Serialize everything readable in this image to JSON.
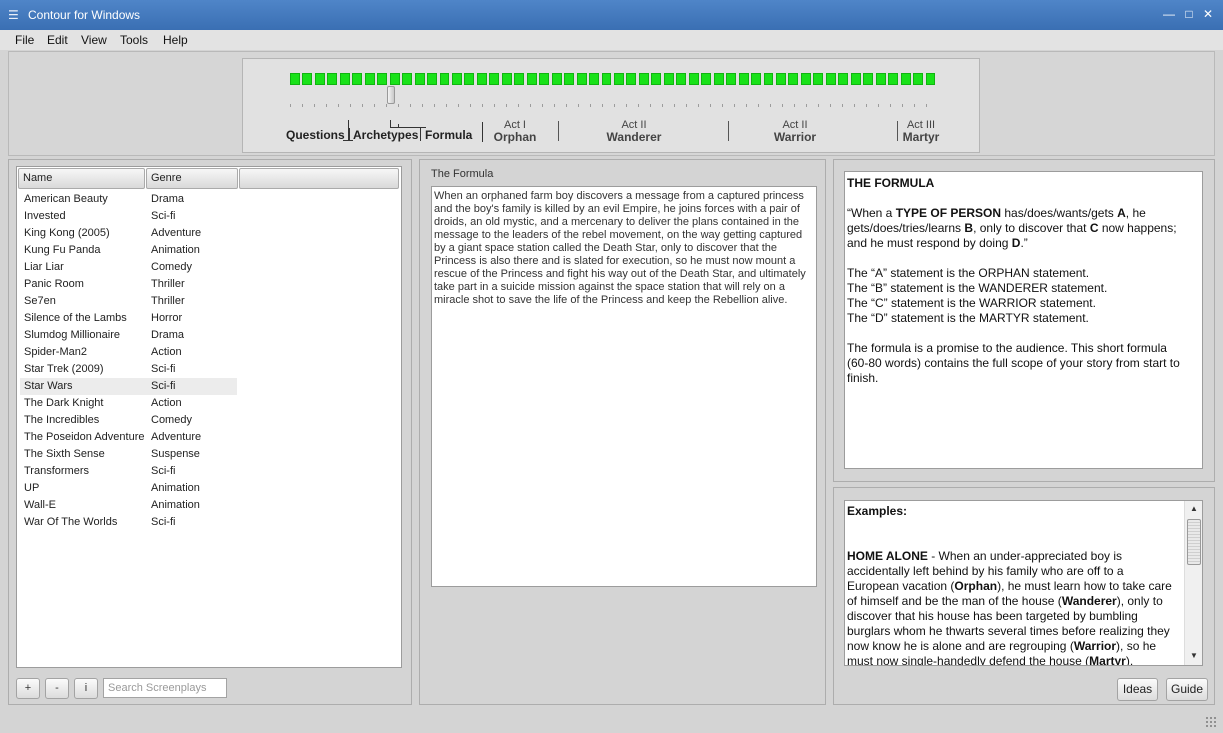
{
  "window": {
    "title": "Contour for Windows"
  },
  "menu": [
    "File",
    "Edit",
    "View",
    "Tools",
    "Help"
  ],
  "timeline": {
    "progress_segments": 52,
    "slider_position": 0.15,
    "stages": [
      "Questions",
      "Archetypes",
      "Formula"
    ],
    "acts": [
      {
        "top": "Act I",
        "bottom": "Orphan"
      },
      {
        "top": "Act II",
        "bottom": "Wanderer"
      },
      {
        "top": "Act II",
        "bottom": "Warrior"
      },
      {
        "top": "Act III",
        "bottom": "Martyr"
      }
    ]
  },
  "screenplays": {
    "columns": [
      "Name",
      "Genre"
    ],
    "rows": [
      {
        "name": "American Beauty",
        "genre": "Drama"
      },
      {
        "name": "Invested",
        "genre": "Sci-fi"
      },
      {
        "name": "King Kong (2005)",
        "genre": "Adventure"
      },
      {
        "name": "Kung Fu Panda",
        "genre": "Animation"
      },
      {
        "name": "Liar Liar",
        "genre": "Comedy"
      },
      {
        "name": "Panic Room",
        "genre": "Thriller"
      },
      {
        "name": "Se7en",
        "genre": "Thriller"
      },
      {
        "name": "Silence of the Lambs",
        "genre": "Horror"
      },
      {
        "name": "Slumdog Millionaire",
        "genre": "Drama"
      },
      {
        "name": "Spider-Man2",
        "genre": "Action"
      },
      {
        "name": "Star Trek (2009)",
        "genre": "Sci-fi"
      },
      {
        "name": "Star Wars",
        "genre": "Sci-fi"
      },
      {
        "name": "The Dark Knight",
        "genre": "Action"
      },
      {
        "name": "The Incredibles",
        "genre": "Comedy"
      },
      {
        "name": "The Poseidon Adventure",
        "genre": "Adventure"
      },
      {
        "name": "The Sixth Sense",
        "genre": "Suspense"
      },
      {
        "name": "Transformers",
        "genre": "Sci-fi"
      },
      {
        "name": "UP",
        "genre": "Animation"
      },
      {
        "name": "Wall-E",
        "genre": "Animation"
      },
      {
        "name": "War Of The Worlds",
        "genre": "Sci-fi"
      }
    ],
    "selected": "Star Wars",
    "toolbar": {
      "add": "+",
      "remove": "-",
      "info": "i",
      "search_placeholder": "Search Screenplays"
    }
  },
  "formula": {
    "heading": "The Formula",
    "lines": [
      "When an orphaned farm boy discovers a message from a captured princess",
      "and the boy's family is killed by an evil Empire, he joins forces with a pair of",
      "droids, an old mystic, and a mercenary to deliver the plans contained in the",
      "message to the leaders of the rebel movement, on the way getting captured",
      "by a giant space station called the Death Star, only to discover that the",
      "Princess is also there and is slated for execution, so he must now mount a",
      "rescue of the Princess and fight his way out of the Death Star, and ultimately",
      "take part in a suicide mission against the space station that will rely on a",
      "miracle shot to save the life of the Princess and keep the Rebellion alive."
    ]
  },
  "guide": {
    "title": "THE FORMULA",
    "template": {
      "l1a": "“When a ",
      "l1b": "TYPE OF PERSON",
      "l1c": " has/does/wants/gets ",
      "l1d": "A",
      "l1e": ", he",
      "l2a": "gets/does/tries/learns ",
      "l2b": "B",
      "l2c": ", only to discover that ",
      "l2d": "C",
      "l2e": " now happens;",
      "l3a": "and he must respond by doing ",
      "l3b": "D",
      "l3c": ".”"
    },
    "statements": [
      "The “A” statement is the ORPHAN statement.",
      "The “B” statement is the WANDERER statement.",
      "The “C” statement is the WARRIOR statement.",
      "The “D” statement is the MARTYR statement."
    ],
    "note_lines": [
      "The formula is a promise to the audience. This short formula",
      "(60-80 words) contains the full scope of your story from start to",
      "finish."
    ]
  },
  "examples": {
    "heading": "Examples:",
    "title": "HOME ALONE",
    "lines": [
      [
        {
          "t": "HOME ALONE",
          "b": true
        },
        {
          "t": " - When an under-appreciated boy is"
        }
      ],
      [
        {
          "t": "accidentally left behind by his family who are off to a"
        }
      ],
      [
        {
          "t": "European vacation ("
        },
        {
          "t": "Orphan",
          "b": true
        },
        {
          "t": "), he must learn how to take care"
        }
      ],
      [
        {
          "t": "of himself and be the man of the house ("
        },
        {
          "t": "Wanderer",
          "b": true
        },
        {
          "t": "), only to"
        }
      ],
      [
        {
          "t": "discover that his house has been targeted by bumbling"
        }
      ],
      [
        {
          "t": "burglars whom he thwarts several times before realizing they"
        }
      ],
      [
        {
          "t": "now know he is alone and are regrouping ("
        },
        {
          "t": "Warrior",
          "b": true
        },
        {
          "t": "), so he"
        }
      ],
      [
        {
          "t": "must now single-handedly defend the house ("
        },
        {
          "t": "Martyr",
          "b": true
        },
        {
          "t": ")."
        }
      ]
    ],
    "scroll_position": 0.0
  },
  "buttons": {
    "ideas": "Ideas",
    "guide": "Guide"
  }
}
